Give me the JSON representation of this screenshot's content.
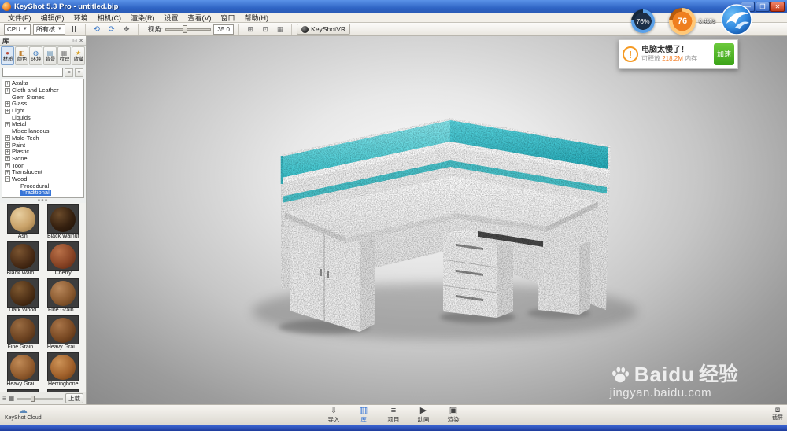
{
  "window": {
    "title": "KeyShot 5.3 Pro  -  untitled.bip"
  },
  "menu": {
    "items": [
      "文件(F)",
      "编辑(E)",
      "环境",
      "相机(C)",
      "渲染(R)",
      "设置",
      "查看(V)",
      "窗口",
      "帮助(H)"
    ]
  },
  "toolbar": {
    "cpu": "CPU",
    "cores": "所有核",
    "fov_label": "视角:",
    "fov_value": "35.0",
    "vr": "KeyShotVR"
  },
  "library": {
    "title": "库",
    "tabs": [
      {
        "label": "材质",
        "glyph": "●",
        "color": "#b84a3a",
        "active": true
      },
      {
        "label": "颜色",
        "glyph": "◧",
        "color": "#c08030",
        "active": false
      },
      {
        "label": "环境",
        "glyph": "◍",
        "color": "#3a7ac0",
        "active": false
      },
      {
        "label": "背景",
        "glyph": "▤",
        "color": "#5a8ab0",
        "active": false
      },
      {
        "label": "纹理",
        "glyph": "▦",
        "color": "#787878",
        "active": false
      },
      {
        "label": "收藏",
        "glyph": "★",
        "color": "#d8a020",
        "active": false
      }
    ],
    "tree": [
      {
        "label": "Axalta",
        "exp": "+"
      },
      {
        "label": "Cloth and Leather",
        "exp": "+"
      },
      {
        "label": "Gem Stones",
        "exp": ""
      },
      {
        "label": "Glass",
        "exp": "+"
      },
      {
        "label": "Light",
        "exp": "+"
      },
      {
        "label": "Liquids",
        "exp": ""
      },
      {
        "label": "Metal",
        "exp": "+"
      },
      {
        "label": "Miscellaneous",
        "exp": ""
      },
      {
        "label": "Mold-Tech",
        "exp": "+"
      },
      {
        "label": "Paint",
        "exp": "+"
      },
      {
        "label": "Plastic",
        "exp": "+"
      },
      {
        "label": "Stone",
        "exp": "+"
      },
      {
        "label": "Toon",
        "exp": "+"
      },
      {
        "label": "Translucent",
        "exp": "+"
      },
      {
        "label": "Wood",
        "exp": "-"
      },
      {
        "label": "Procedural",
        "exp": "",
        "child": true
      },
      {
        "label": "Traditional",
        "exp": "",
        "child": true,
        "selected": true
      }
    ],
    "materials": [
      {
        "name": "Ash",
        "color": "#c9a269",
        "hi": "#e8cfa0",
        "lo": "#8a6a3a"
      },
      {
        "name": "Black Walnut",
        "color": "#35200f",
        "hi": "#6a4a2a",
        "lo": "#1a0e06"
      },
      {
        "name": "Black Waln...",
        "color": "#4a2c16",
        "hi": "#7a5430",
        "lo": "#241204"
      },
      {
        "name": "Cherry",
        "color": "#8a4526",
        "hi": "#b87048",
        "lo": "#55230f"
      },
      {
        "name": "Dark Wood",
        "color": "#4e3016",
        "hi": "#7e5830",
        "lo": "#261404"
      },
      {
        "name": "Fine Grain...",
        "color": "#8a5a30",
        "hi": "#b8875a",
        "lo": "#553312"
      },
      {
        "name": "Fine Grain...",
        "color": "#6e4422",
        "hi": "#9a6c42",
        "lo": "#3e2410"
      },
      {
        "name": "Heavy Grai...",
        "color": "#7a4a24",
        "hi": "#a87448",
        "lo": "#48260e"
      },
      {
        "name": "Heavy Grai...",
        "color": "#925c2e",
        "hi": "#c08a56",
        "lo": "#5a3314"
      },
      {
        "name": "Herringbone",
        "color": "#a2622c",
        "hi": "#cc9256",
        "lo": "#643610"
      },
      {
        "name": "",
        "color": "#3a2414",
        "hi": "#64452a",
        "lo": "#1c0f06"
      },
      {
        "name": "",
        "color": "#5a3a20",
        "hi": "#8a6440",
        "lo": "#30190a"
      }
    ],
    "upload": "上载"
  },
  "bottom": {
    "cloud": "KeyShot Cloud",
    "buttons": [
      {
        "label": "导入",
        "glyph": "⇩",
        "active": false
      },
      {
        "label": "库",
        "glyph": "▥",
        "active": true
      },
      {
        "label": "项目",
        "glyph": "≡",
        "active": false
      },
      {
        "label": "动画",
        "glyph": "▶",
        "active": false
      },
      {
        "label": "渲染",
        "glyph": "▣",
        "active": false
      }
    ],
    "screenshot": "截屏"
  },
  "overlay": {
    "gauge1": "76%",
    "gauge2": "76",
    "speed": "0.4M/s",
    "popup": {
      "title": "电脑太慢了！",
      "line_prefix": "可释放 ",
      "line_value": "218.2M",
      "line_suffix": " 内存",
      "button": "加速"
    }
  },
  "watermark": {
    "brand": "Baidu",
    "brand_cn": "经验",
    "url": "jingyan.baidu.com"
  },
  "accent_colors": {
    "glass_teal": "#3ec6d0",
    "ui_blue": "#2a6cd4",
    "warn_orange": "#f57b20"
  }
}
